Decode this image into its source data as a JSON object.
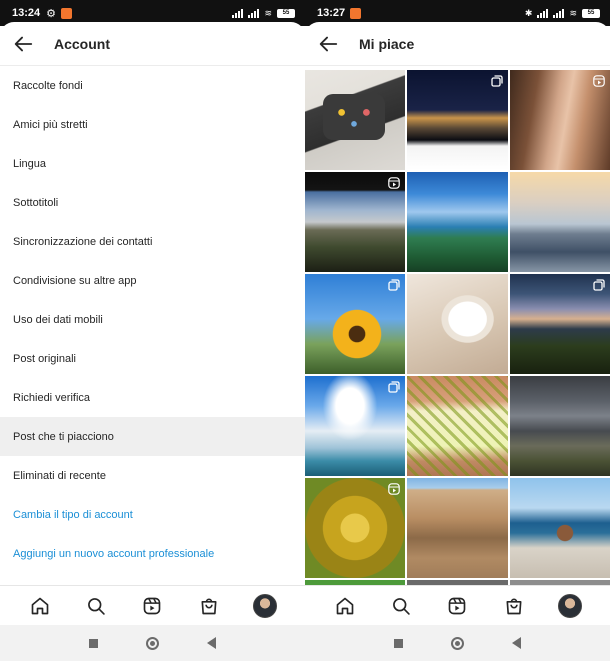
{
  "left": {
    "status": {
      "time": "13:24",
      "battery": "55"
    },
    "header": {
      "title": "Account"
    },
    "menu": [
      {
        "label": "Raccolte fondi"
      },
      {
        "label": "Amici più stretti"
      },
      {
        "label": "Lingua"
      },
      {
        "label": "Sottotitoli"
      },
      {
        "label": "Sincronizzazione dei contatti"
      },
      {
        "label": "Condivisione su altre app"
      },
      {
        "label": "Uso dei dati mobili"
      },
      {
        "label": "Post originali"
      },
      {
        "label": "Richiedi verifica"
      },
      {
        "label": "Post che ti piacciono"
      },
      {
        "label": "Eliminati di recente"
      },
      {
        "label": "Cambia il tipo di account"
      },
      {
        "label": "Aggiungi un nuovo account professionale"
      }
    ]
  },
  "right": {
    "status": {
      "time": "13:27",
      "battery": "55"
    },
    "header": {
      "title": "Mi piace"
    },
    "grid": [
      {
        "badge": "none"
      },
      {
        "badge": "multiple-icon"
      },
      {
        "badge": "reels-icon"
      },
      {
        "badge": "reels-icon"
      },
      {
        "badge": "none"
      },
      {
        "badge": "none"
      },
      {
        "badge": "multiple-icon"
      },
      {
        "badge": "none"
      },
      {
        "badge": "multiple-icon"
      },
      {
        "badge": "multiple-icon"
      },
      {
        "badge": "none"
      },
      {
        "badge": "none"
      },
      {
        "badge": "reels-icon"
      },
      {
        "badge": "none"
      },
      {
        "badge": "none"
      }
    ]
  },
  "nav_icons": [
    "home-icon",
    "search-icon",
    "reels-icon",
    "shop-icon",
    "profile-avatar"
  ],
  "colors": {
    "link_blue": "#1b8fd6",
    "active_row": "#efefef",
    "status_bar": "#111111"
  }
}
